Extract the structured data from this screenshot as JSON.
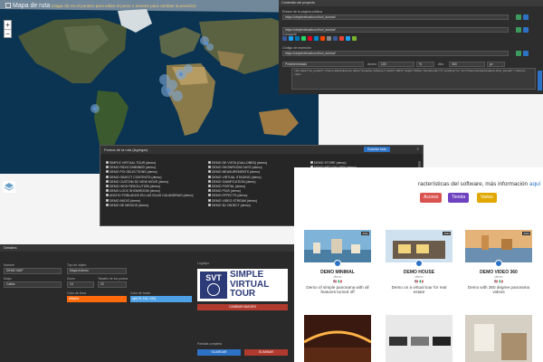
{
  "map": {
    "title": "Mapa de ruta",
    "subtitle": "(Haga clic en el puntero para editar el punto o arrastre para cambiar la posición)",
    "zoom_in": "+",
    "zoom_out": "−"
  },
  "form": {
    "header": "Contenido del proyecto",
    "link_label": "Enlace de la página pública",
    "link_value": "https://simplevirtualtour.it/svt_tutorial/",
    "share_label": "Compartir",
    "embed_label": "Código de inserción",
    "embed_link": "https://simplevirtualtour.it/svt_tutorial/",
    "width_label": "Ancho",
    "width_value": "100",
    "unit_value": "%",
    "height_label": "Alto",
    "height_value": "300",
    "unit2_value": "px",
    "mode_value": "Predeterminado",
    "code_text": "<div class=\"svt_embed\"><iframe allowfullscreen allow=\"autoplay; fullscreen\" width=\"100%\" height=\"300px\" frameborder=\"0\" scrolling=\"no\" src=\"https://simplevirtualtour.it/svt_tutorial/\"></iframe></div>"
  },
  "route": {
    "title": "Puntos de la ruta (Agregar)",
    "save": "Guardar todo",
    "close": "×",
    "points": [
      "SIMPLE VIRTUAL TOUR (demo)",
      "DEMO DE VISTA (GALLOBED) (demo)",
      "DEMO STORE (demo)",
      "DEMO RIDOCOMBINED (demo)",
      "DEMO SHOWROOM DAYS (demo)",
      "DEMO ART GALLERY (demo)",
      "DEMO POI SELECTIONS (demo)",
      "DEMO MEASUREMENTS (demo)",
      "DEMO HOUSE (demo)",
      "DEMO OBJECT CONTENTS (demo)",
      "DEMO VIRTUAL STAGING (demo)",
      "DEMO 3D VISUALIZATION (demo)",
      "DEMO CUSTOM 3D VIEW MOVE (demo)",
      "DEMO GAMIFICATION (demo)",
      "DEMO AUTOMOTIVE (demo)",
      "DEMO HIGH RESOLUTION (demo)",
      "DEMO PORTAL (demo)",
      "DEMO VIDEO 360 (demo)",
      "DEMO LOCK SHOWROOM (demo)",
      "DEMO POIS (demo)",
      "DEMO STREETS (demo)",
      "ANCHO POBLADOS EN LAS ISLAS CALANDRIAS (demo)",
      "DEMO EFFECTS (demo)",
      "DEMO CITY (demo)",
      "DEMO INICIO (demo)",
      "DEMO VIDEO STREAM (demo)",
      "DEMO LOTTIE (demo)",
      "DEMO DE MEDIOS (demo)",
      "DEMO 3D OBJECT (demo)",
      "DEMO SLIDESHOW (demo)"
    ]
  },
  "settings": {
    "header": "Detalles",
    "name_label": "Nombre",
    "name_value": "DEMO MAP",
    "type_label": "Tipo de objeto",
    "type_value": "Mapa externo",
    "map_label": "Mapa",
    "map_value": "Calles",
    "zoom_label": "Zoom",
    "zoom_value": "14",
    "points_label": "Tamaño de los puntos",
    "points_value": "22",
    "color_label": "Color de línea",
    "color_value": "#ff6a0d",
    "color_hex": "#ff6a0d",
    "bg_label": "Color de fondo",
    "bg_value": "rgb(78, 161, 230)",
    "bg_hex": "#4ea1e6",
    "logo_label": "Logotipo",
    "logo_main": "SVT",
    "logo_text": "SIMPLE VIRTUAL TOUR",
    "change_logo": "CAMBIAR IMAGEN",
    "fullscreen_label": "Pantalla completa",
    "save_btn": "GUARDAR",
    "delete_btn": "ELIMINAR"
  },
  "gallery": {
    "description": "racterísticas del software, más información",
    "link": "aquí",
    "chips": [
      {
        "label": "Acceso",
        "color": "#d9534f"
      },
      {
        "label": "Tienda",
        "color": "#6f42c1"
      },
      {
        "label": "Varios",
        "color": "#e0a800"
      }
    ],
    "cards": [
      {
        "title": "DEMO MINIMAL",
        "category": "demo",
        "flags": "🇺🇸 🇮🇹",
        "desc": "Demo of simple panorama with all features turned off"
      },
      {
        "title": "DEMO HOUSE",
        "category": "demo",
        "flags": "🇺🇸 🇮🇹",
        "desc": "Demo on a virtual tour for real estate"
      },
      {
        "title": "DEMO VIDEO 360",
        "category": "demo",
        "flags": "🇺🇸 🇮🇹",
        "desc": "Demo with 360 degree panorama videos"
      }
    ],
    "badge": "2022"
  }
}
